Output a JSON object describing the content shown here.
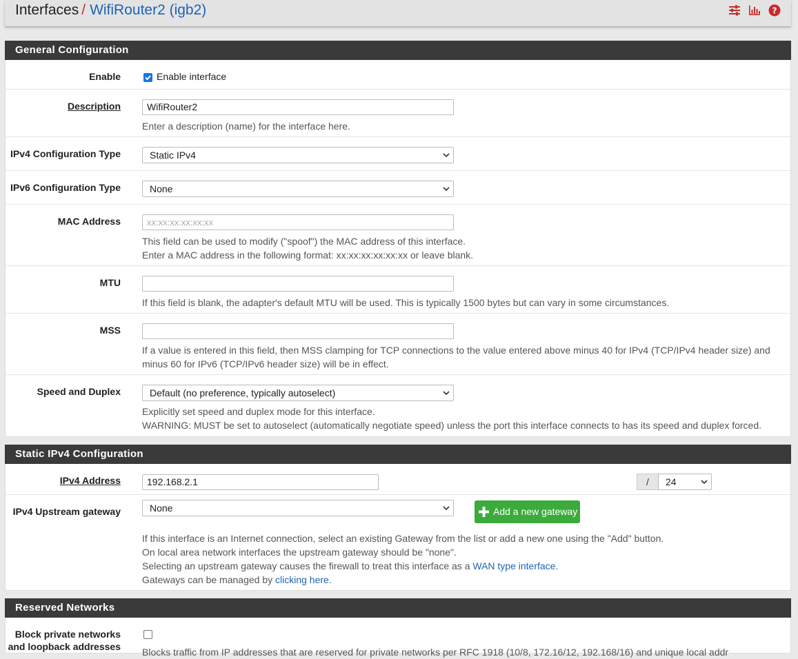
{
  "header": {
    "crumb1": "Interfaces",
    "separator": "/",
    "crumb2": "WifiRouter2 (igb2)",
    "icons": [
      "sliders-icon",
      "bar-chart-icon",
      "help-icon"
    ],
    "accent": "#c92b2b"
  },
  "general": {
    "title": "General Configuration",
    "enable_label": "Enable",
    "enable_text": "Enable interface",
    "enable_checked": true,
    "description_label": "Description",
    "description_value": "WifiRouter2",
    "description_help": "Enter a description (name) for the interface here.",
    "ipv4type_label": "IPv4 Configuration Type",
    "ipv4type_value": "Static IPv4",
    "ipv6type_label": "IPv6 Configuration Type",
    "ipv6type_value": "None",
    "mac_label": "MAC Address",
    "mac_placeholder": "xx:xx:xx:xx:xx:xx",
    "mac_help1": "This field can be used to modify (\"spoof\") the MAC address of this interface.",
    "mac_help2": "Enter a MAC address in the following format: xx:xx:xx:xx:xx:xx or leave blank.",
    "mtu_label": "MTU",
    "mtu_help": "If this field is blank, the adapter's default MTU will be used. This is typically 1500 bytes but can vary in some circumstances.",
    "mss_label": "MSS",
    "mss_help1": "If a value is entered in this field, then MSS clamping for TCP connections to the value entered above minus 40 for IPv4 (TCP/IPv4 header size) and",
    "mss_help2": "minus 60 for IPv6 (TCP/IPv6 header size) will be in effect.",
    "speed_label": "Speed and Duplex",
    "speed_value": "Default (no preference, typically autoselect)",
    "speed_help1": "Explicitly set speed and duplex mode for this interface.",
    "speed_help2": "WARNING: MUST be set to autoselect (automatically negotiate speed) unless the port this interface connects to has its speed and duplex forced."
  },
  "static4": {
    "title": "Static IPv4 Configuration",
    "addr_label": "IPv4 Address",
    "addr_value": "192.168.2.1",
    "slash": "/",
    "mask_value": "24",
    "gw_label": "IPv4 Upstream gateway",
    "gw_value": "None",
    "add_gw_button": "Add a new gateway",
    "gw_help1": "If this interface is an Internet connection, select an existing Gateway from the list or add a new one using the \"Add\" button.",
    "gw_help2": "On local area network interfaces the upstream gateway should be \"none\".",
    "gw_help3_pre": "Selecting an upstream gateway causes the firewall to treat this interface as a ",
    "gw_help3_link": "WAN type interface",
    "gw_help3_post": ".",
    "gw_help4_pre": "Gateways can be managed by ",
    "gw_help4_link": "clicking here",
    "gw_help4_post": "."
  },
  "reserved": {
    "title": "Reserved Networks",
    "block_label1": "Block private networks",
    "block_label2": "and loopback addresses",
    "block_checked": false,
    "block_help": "Blocks traffic from IP addresses that are reserved for private networks per RFC 1918 (10/8, 172.16/12, 192.168/16) and unique local addr"
  }
}
